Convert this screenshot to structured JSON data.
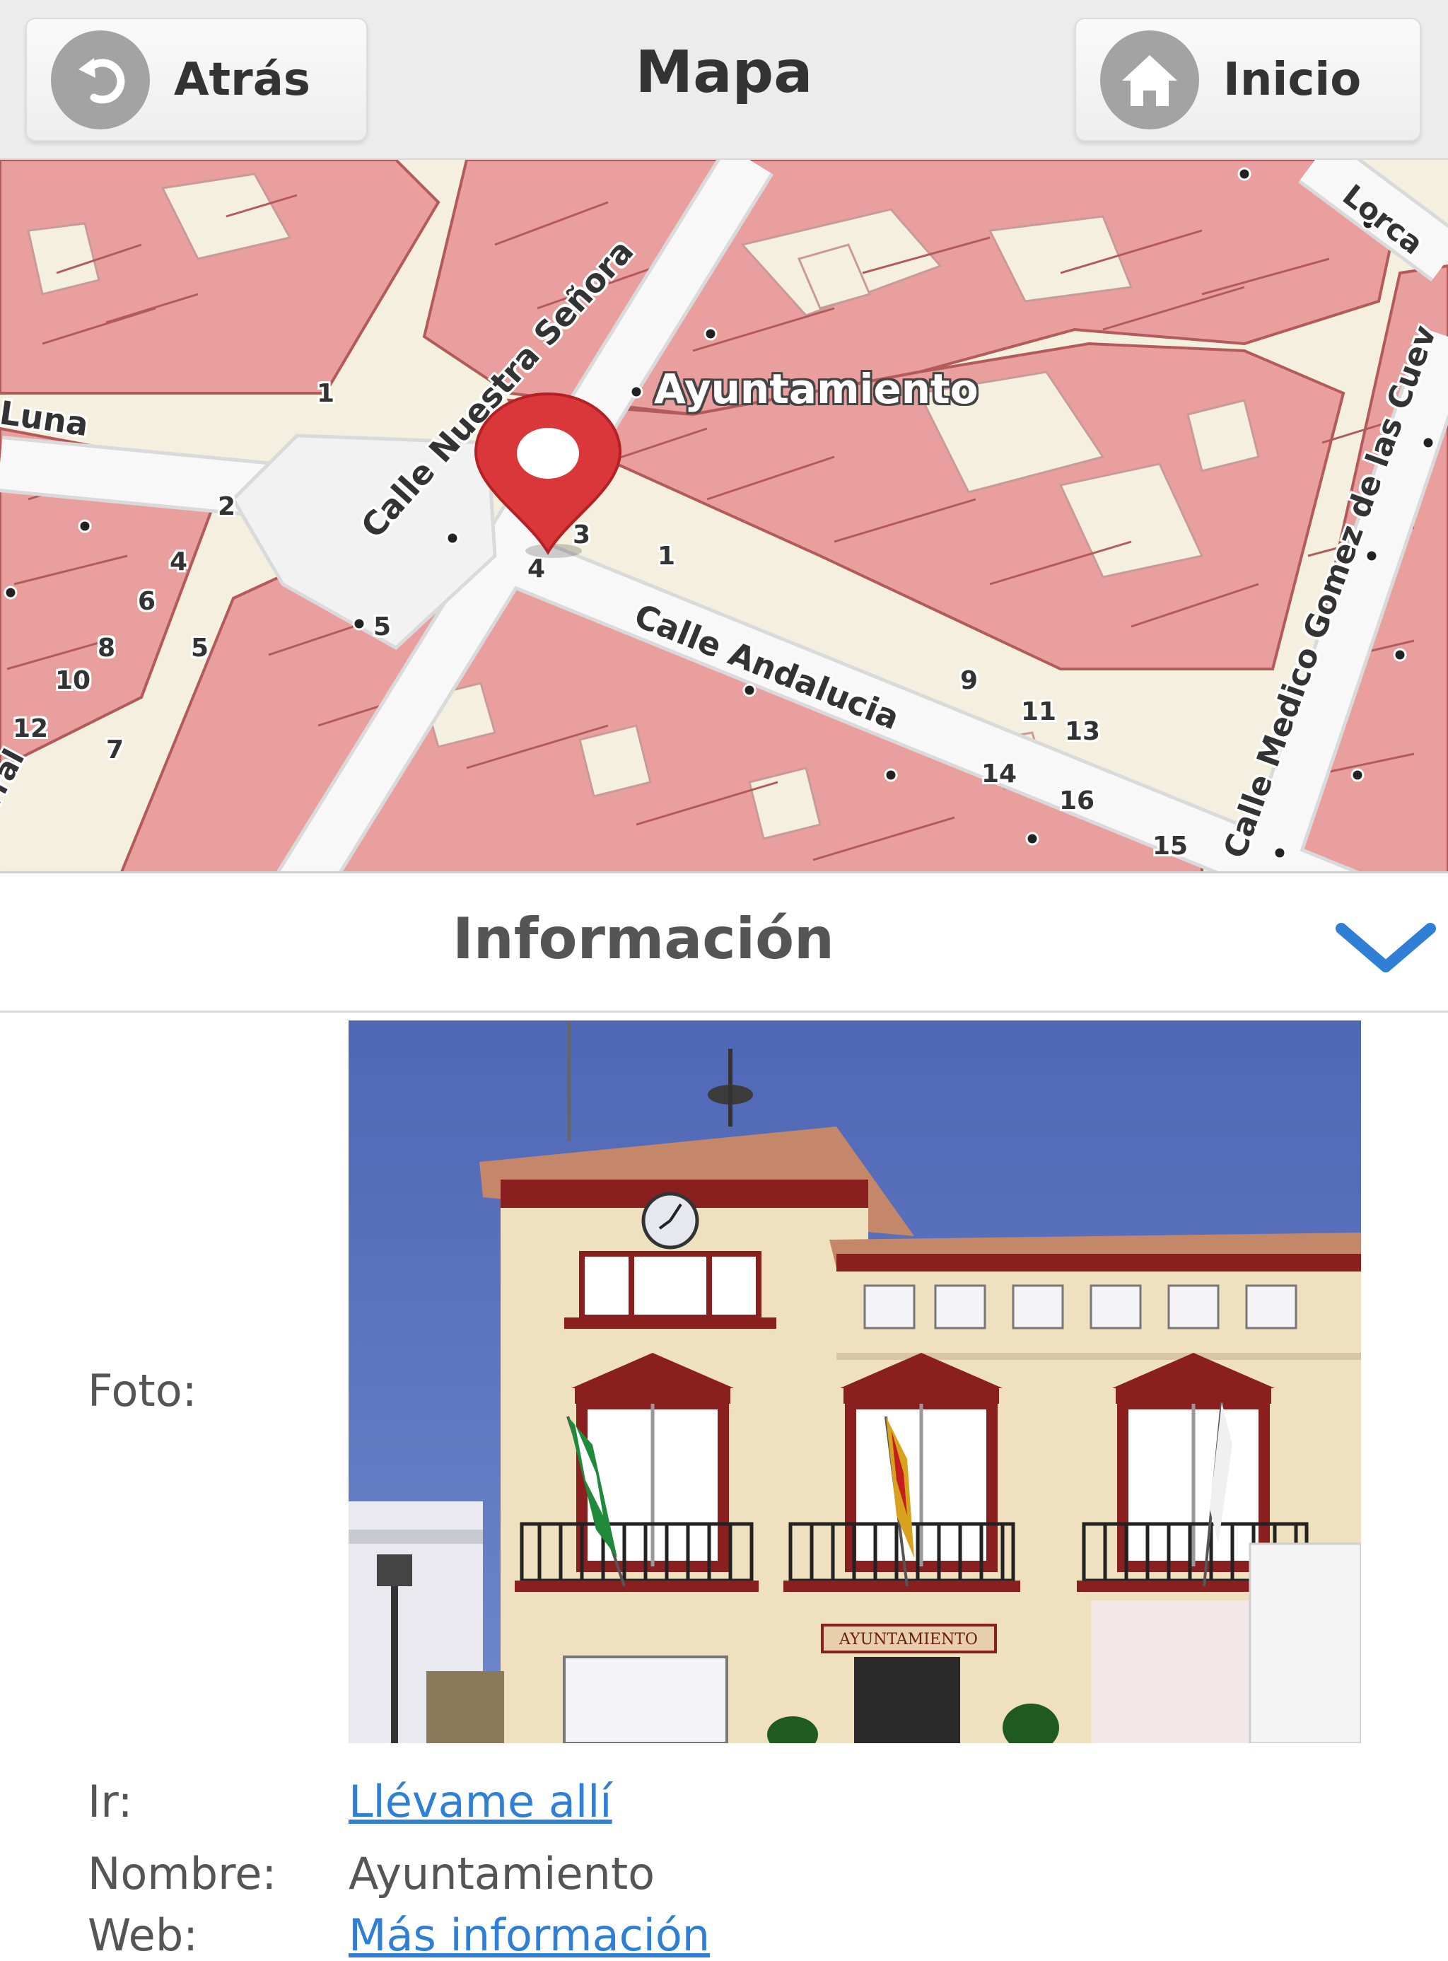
{
  "header": {
    "back_label": "Atrás",
    "title": "Mapa",
    "home_label": "Inicio"
  },
  "map": {
    "place_label": "Ayuntamiento",
    "streets": [
      "Calle Nuestra Señora",
      "Calle Andalucia",
      "Calle Medico Gomez de las Cuev",
      "Luna",
      "Lorca",
      "errral"
    ],
    "house_numbers": [
      "1",
      "2",
      "4",
      "6",
      "8",
      "10",
      "12",
      "7",
      "5",
      "5",
      "4",
      "3",
      "1",
      "9",
      "11",
      "13",
      "14",
      "16",
      "15"
    ]
  },
  "info": {
    "title": "Información",
    "photo_label": "Foto:",
    "photo_sign": "AYUNTAMIENTO",
    "go_label": "Ir:",
    "go_link": "Llévame allí",
    "name_label": "Nombre:",
    "name_value": "Ayuntamiento",
    "web_label": "Web:",
    "web_link": "Más información"
  },
  "colors": {
    "building": "#ea9f9f",
    "building_edge": "#b35a5a",
    "land": "#f4efdf",
    "road": "#f5f5f5",
    "pin": "#d9373a",
    "link": "#2f7fd6",
    "chevron": "#2f7fd6"
  }
}
